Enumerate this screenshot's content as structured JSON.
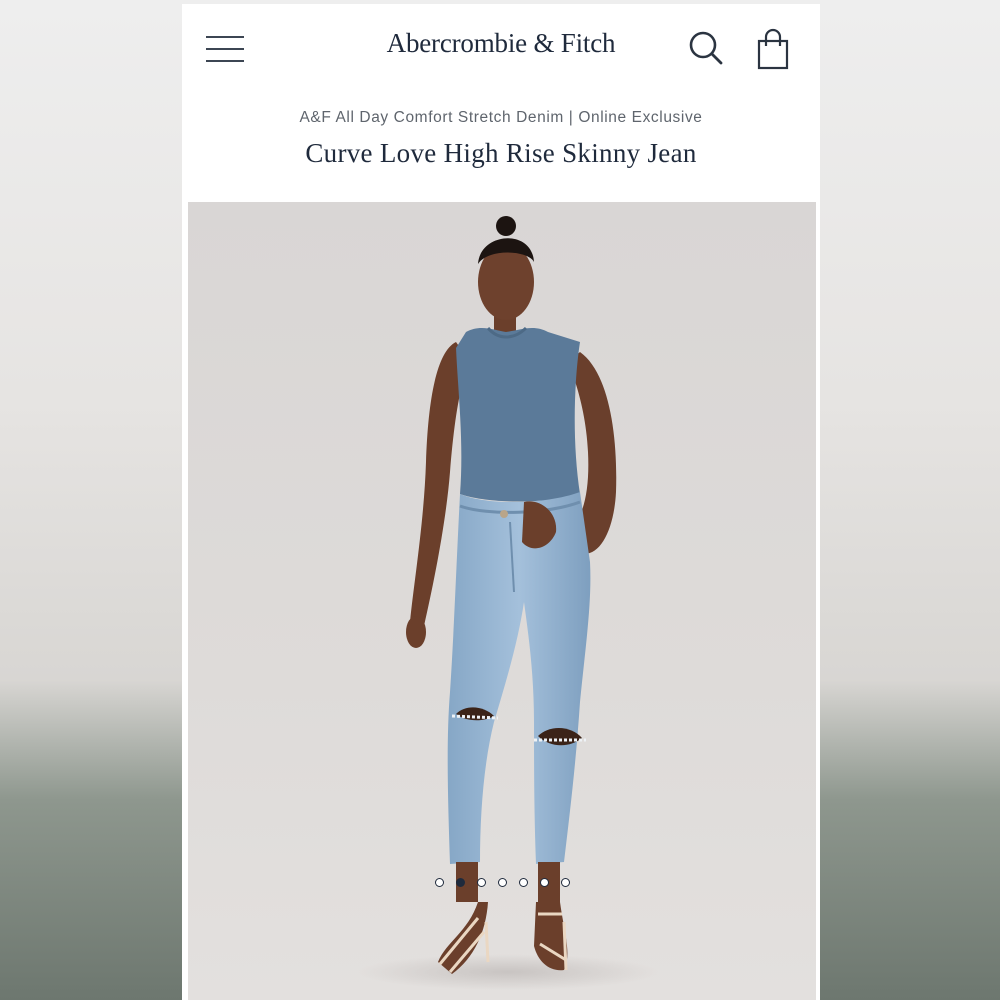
{
  "header": {
    "brand": "Abercrombie & Fitch",
    "menu_icon": "hamburger-menu-icon",
    "search_icon": "search-icon",
    "bag_icon": "shopping-bag-icon"
  },
  "product": {
    "collection": "A&F All Day Comfort Stretch Denim | Online Exclusive",
    "name": "Curve Love High Rise Skinny Jean"
  },
  "gallery": {
    "image_count": 7,
    "active_index": 1
  },
  "colors": {
    "brand_navy": "#1f2a3c",
    "top_blue": "#5b7a99",
    "denim": "#8fb0cf"
  }
}
